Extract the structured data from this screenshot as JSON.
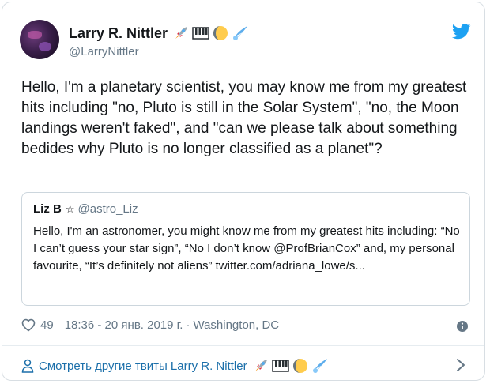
{
  "author": {
    "name": "Larry R. Nittler",
    "handle": "@LarryNittler",
    "emoji_icons": [
      "rocket-icon",
      "piano-keys-icon",
      "moon-icon",
      "comet-icon"
    ]
  },
  "tweet": {
    "text": "Hello,  I'm a planetary scientist,  you may know me from my greatest hits including \"no, Pluto is still in the Solar System\", \"no, the Moon landings weren't faked\", and \"can we please talk about something bedides why Pluto is no longer classified as a planet\"?"
  },
  "quoted_tweet": {
    "name": "Liz B",
    "star": "☆",
    "handle": "@astro_Liz",
    "text": "Hello, I'm an astronomer, you might know me from my greatest hits including: “No I can’t guess your star sign”, “No I don’t know @ProfBrianCox” and, my personal favourite, “It’s definitely not aliens” twitter.com/adriana_lowe/s..."
  },
  "meta": {
    "likes": "49",
    "time": "18:36 - 20 янв. 2019 г.",
    "separator": "·",
    "location": "Washington, DC"
  },
  "footer": {
    "more_tweets_label": "Смотреть другие твиты Larry R. Nittler"
  },
  "colors": {
    "twitter_blue": "#1da1f2",
    "link_blue": "#1b6faa",
    "secondary_text": "#657786"
  }
}
